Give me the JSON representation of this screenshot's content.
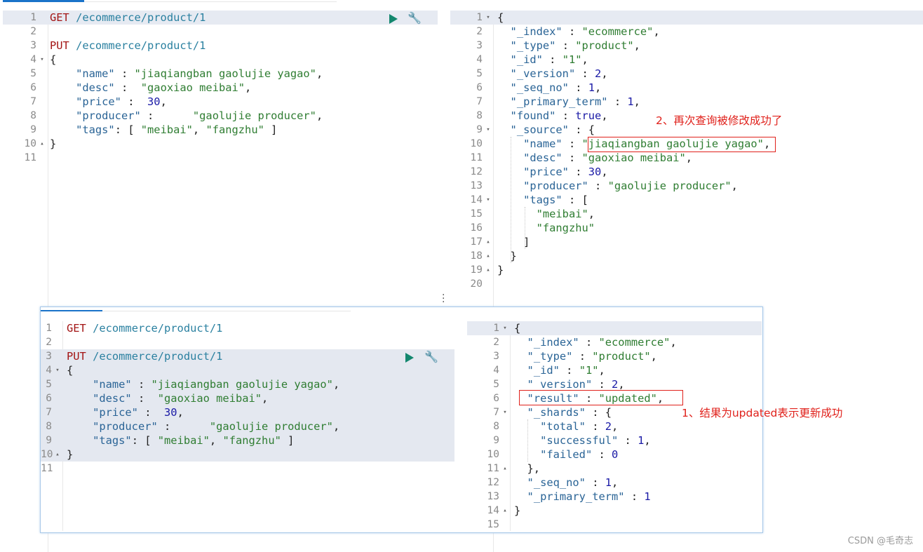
{
  "top_request": {
    "lines": [
      {
        "n": "1",
        "fold": "",
        "parts": [
          [
            "k",
            "GET"
          ],
          [
            "p",
            " "
          ],
          [
            "u",
            "/ecommerce/product/1"
          ]
        ]
      },
      {
        "n": "2",
        "fold": "",
        "parts": []
      },
      {
        "n": "3",
        "fold": "",
        "parts": [
          [
            "k",
            "PUT"
          ],
          [
            "p",
            " "
          ],
          [
            "u",
            "/ecommerce/product/1"
          ]
        ]
      },
      {
        "n": "4",
        "fold": "▾",
        "parts": [
          [
            "p",
            "{"
          ]
        ]
      },
      {
        "n": "5",
        "fold": "",
        "parts": [
          [
            "p",
            "    "
          ],
          [
            "key",
            "\"name\""
          ],
          [
            "p",
            " : "
          ],
          [
            "s",
            "\"jiaqiangban gaolujie yagao\""
          ],
          [
            "p",
            ","
          ]
        ]
      },
      {
        "n": "6",
        "fold": "",
        "parts": [
          [
            "p",
            "    "
          ],
          [
            "key",
            "\"desc\""
          ],
          [
            "p",
            " :  "
          ],
          [
            "s",
            "\"gaoxiao meibai\""
          ],
          [
            "p",
            ","
          ]
        ]
      },
      {
        "n": "7",
        "fold": "",
        "parts": [
          [
            "p",
            "    "
          ],
          [
            "key",
            "\"price\""
          ],
          [
            "p",
            " :  "
          ],
          [
            "n",
            "30"
          ],
          [
            "p",
            ","
          ]
        ]
      },
      {
        "n": "8",
        "fold": "",
        "parts": [
          [
            "p",
            "    "
          ],
          [
            "key",
            "\"producer\""
          ],
          [
            "p",
            " :      "
          ],
          [
            "s",
            "\"gaolujie producer\""
          ],
          [
            "p",
            ","
          ]
        ]
      },
      {
        "n": "9",
        "fold": "",
        "parts": [
          [
            "p",
            "    "
          ],
          [
            "key",
            "\"tags\""
          ],
          [
            "p",
            ": [ "
          ],
          [
            "s",
            "\"meibai\""
          ],
          [
            "p",
            ", "
          ],
          [
            "s",
            "\"fangzhu\""
          ],
          [
            "p",
            " ]"
          ]
        ]
      },
      {
        "n": "10",
        "fold": "▴",
        "parts": [
          [
            "p",
            "}"
          ]
        ]
      },
      {
        "n": "11",
        "fold": "",
        "parts": []
      }
    ]
  },
  "top_response": {
    "lines": [
      {
        "n": "1",
        "fold": "▾",
        "parts": [
          [
            "p",
            "{"
          ]
        ]
      },
      {
        "n": "2",
        "fold": "",
        "parts": [
          [
            "p",
            "  "
          ],
          [
            "key",
            "\"_index\""
          ],
          [
            "p",
            " : "
          ],
          [
            "s",
            "\"ecommerce\""
          ],
          [
            "p",
            ","
          ]
        ]
      },
      {
        "n": "3",
        "fold": "",
        "parts": [
          [
            "p",
            "  "
          ],
          [
            "key",
            "\"_type\""
          ],
          [
            "p",
            " : "
          ],
          [
            "s",
            "\"product\""
          ],
          [
            "p",
            ","
          ]
        ]
      },
      {
        "n": "4",
        "fold": "",
        "parts": [
          [
            "p",
            "  "
          ],
          [
            "key",
            "\"_id\""
          ],
          [
            "p",
            " : "
          ],
          [
            "s",
            "\"1\""
          ],
          [
            "p",
            ","
          ]
        ]
      },
      {
        "n": "5",
        "fold": "",
        "parts": [
          [
            "p",
            "  "
          ],
          [
            "key",
            "\"_version\""
          ],
          [
            "p",
            " : "
          ],
          [
            "n",
            "2"
          ],
          [
            "p",
            ","
          ]
        ]
      },
      {
        "n": "6",
        "fold": "",
        "parts": [
          [
            "p",
            "  "
          ],
          [
            "key",
            "\"_seq_no\""
          ],
          [
            "p",
            " : "
          ],
          [
            "n",
            "1"
          ],
          [
            "p",
            ","
          ]
        ]
      },
      {
        "n": "7",
        "fold": "",
        "parts": [
          [
            "p",
            "  "
          ],
          [
            "key",
            "\"_primary_term\""
          ],
          [
            "p",
            " : "
          ],
          [
            "n",
            "1"
          ],
          [
            "p",
            ","
          ]
        ]
      },
      {
        "n": "8",
        "fold": "",
        "parts": [
          [
            "p",
            "  "
          ],
          [
            "key",
            "\"found\""
          ],
          [
            "p",
            " : "
          ],
          [
            "n",
            "true"
          ],
          [
            "p",
            ","
          ]
        ]
      },
      {
        "n": "9",
        "fold": "▾",
        "parts": [
          [
            "p",
            "  "
          ],
          [
            "key",
            "\"_source\""
          ],
          [
            "p",
            " : {"
          ]
        ]
      },
      {
        "n": "10",
        "fold": "",
        "parts": [
          [
            "p",
            "    "
          ],
          [
            "key",
            "\"name\""
          ],
          [
            "p",
            " : "
          ],
          [
            "s",
            "\"jiaqiangban gaolujie yagao\""
          ],
          [
            "p",
            ","
          ]
        ]
      },
      {
        "n": "11",
        "fold": "",
        "parts": [
          [
            "p",
            "    "
          ],
          [
            "key",
            "\"desc\""
          ],
          [
            "p",
            " : "
          ],
          [
            "s",
            "\"gaoxiao meibai\""
          ],
          [
            "p",
            ","
          ]
        ]
      },
      {
        "n": "12",
        "fold": "",
        "parts": [
          [
            "p",
            "    "
          ],
          [
            "key",
            "\"price\""
          ],
          [
            "p",
            " : "
          ],
          [
            "n",
            "30"
          ],
          [
            "p",
            ","
          ]
        ]
      },
      {
        "n": "13",
        "fold": "",
        "parts": [
          [
            "p",
            "    "
          ],
          [
            "key",
            "\"producer\""
          ],
          [
            "p",
            " : "
          ],
          [
            "s",
            "\"gaolujie producer\""
          ],
          [
            "p",
            ","
          ]
        ]
      },
      {
        "n": "14",
        "fold": "▾",
        "parts": [
          [
            "p",
            "    "
          ],
          [
            "key",
            "\"tags\""
          ],
          [
            "p",
            " : ["
          ]
        ]
      },
      {
        "n": "15",
        "fold": "",
        "parts": [
          [
            "p",
            "      "
          ],
          [
            "s",
            "\"meibai\""
          ],
          [
            "p",
            ","
          ]
        ]
      },
      {
        "n": "16",
        "fold": "",
        "parts": [
          [
            "p",
            "      "
          ],
          [
            "s",
            "\"fangzhu\""
          ]
        ]
      },
      {
        "n": "17",
        "fold": "▴",
        "parts": [
          [
            "p",
            "    ]"
          ]
        ]
      },
      {
        "n": "18",
        "fold": "▴",
        "parts": [
          [
            "p",
            "  }"
          ]
        ]
      },
      {
        "n": "19",
        "fold": "▴",
        "parts": [
          [
            "p",
            "}"
          ]
        ]
      },
      {
        "n": "20",
        "fold": "",
        "parts": []
      }
    ]
  },
  "bottom_request": {
    "lines": [
      {
        "n": "1",
        "fold": "",
        "parts": [
          [
            "k",
            "GET"
          ],
          [
            "p",
            " "
          ],
          [
            "u",
            "/ecommerce/product/1"
          ]
        ]
      },
      {
        "n": "2",
        "fold": "",
        "parts": []
      },
      {
        "n": "3",
        "fold": "",
        "parts": [
          [
            "k",
            "PUT"
          ],
          [
            "p",
            " "
          ],
          [
            "u",
            "/ecommerce/product/1"
          ]
        ]
      },
      {
        "n": "4",
        "fold": "▾",
        "parts": [
          [
            "p",
            "{"
          ]
        ]
      },
      {
        "n": "5",
        "fold": "",
        "parts": [
          [
            "p",
            "    "
          ],
          [
            "key",
            "\"name\""
          ],
          [
            "p",
            " : "
          ],
          [
            "s",
            "\"jiaqiangban gaolujie yagao\""
          ],
          [
            "p",
            ","
          ]
        ]
      },
      {
        "n": "6",
        "fold": "",
        "parts": [
          [
            "p",
            "    "
          ],
          [
            "key",
            "\"desc\""
          ],
          [
            "p",
            " :  "
          ],
          [
            "s",
            "\"gaoxiao meibai\""
          ],
          [
            "p",
            ","
          ]
        ]
      },
      {
        "n": "7",
        "fold": "",
        "parts": [
          [
            "p",
            "    "
          ],
          [
            "key",
            "\"price\""
          ],
          [
            "p",
            " :  "
          ],
          [
            "n",
            "30"
          ],
          [
            "p",
            ","
          ]
        ]
      },
      {
        "n": "8",
        "fold": "",
        "parts": [
          [
            "p",
            "    "
          ],
          [
            "key",
            "\"producer\""
          ],
          [
            "p",
            " :      "
          ],
          [
            "s",
            "\"gaolujie producer\""
          ],
          [
            "p",
            ","
          ]
        ]
      },
      {
        "n": "9",
        "fold": "",
        "parts": [
          [
            "p",
            "    "
          ],
          [
            "key",
            "\"tags\""
          ],
          [
            "p",
            ": [ "
          ],
          [
            "s",
            "\"meibai\""
          ],
          [
            "p",
            ", "
          ],
          [
            "s",
            "\"fangzhu\""
          ],
          [
            "p",
            " ]"
          ]
        ]
      },
      {
        "n": "10",
        "fold": "▴",
        "parts": [
          [
            "p",
            "}"
          ]
        ]
      },
      {
        "n": "11",
        "fold": "",
        "parts": []
      }
    ]
  },
  "bottom_response": {
    "lines": [
      {
        "n": "1",
        "fold": "▾",
        "parts": [
          [
            "p",
            "{"
          ]
        ]
      },
      {
        "n": "2",
        "fold": "",
        "parts": [
          [
            "p",
            "  "
          ],
          [
            "key",
            "\"_index\""
          ],
          [
            "p",
            " : "
          ],
          [
            "s",
            "\"ecommerce\""
          ],
          [
            "p",
            ","
          ]
        ]
      },
      {
        "n": "3",
        "fold": "",
        "parts": [
          [
            "p",
            "  "
          ],
          [
            "key",
            "\"_type\""
          ],
          [
            "p",
            " : "
          ],
          [
            "s",
            "\"product\""
          ],
          [
            "p",
            ","
          ]
        ]
      },
      {
        "n": "4",
        "fold": "",
        "parts": [
          [
            "p",
            "  "
          ],
          [
            "key",
            "\"_id\""
          ],
          [
            "p",
            " : "
          ],
          [
            "s",
            "\"1\""
          ],
          [
            "p",
            ","
          ]
        ]
      },
      {
        "n": "5",
        "fold": "",
        "parts": [
          [
            "p",
            "  "
          ],
          [
            "key",
            "\"_version\""
          ],
          [
            "p",
            " : "
          ],
          [
            "n",
            "2"
          ],
          [
            "p",
            ","
          ]
        ]
      },
      {
        "n": "6",
        "fold": "",
        "parts": [
          [
            "p",
            "  "
          ],
          [
            "key",
            "\"result\""
          ],
          [
            "p",
            " : "
          ],
          [
            "s",
            "\"updated\""
          ],
          [
            "p",
            ","
          ]
        ]
      },
      {
        "n": "7",
        "fold": "▾",
        "parts": [
          [
            "p",
            "  "
          ],
          [
            "key",
            "\"_shards\""
          ],
          [
            "p",
            " : {"
          ]
        ]
      },
      {
        "n": "8",
        "fold": "",
        "parts": [
          [
            "p",
            "    "
          ],
          [
            "key",
            "\"total\""
          ],
          [
            "p",
            " : "
          ],
          [
            "n",
            "2"
          ],
          [
            "p",
            ","
          ]
        ]
      },
      {
        "n": "9",
        "fold": "",
        "parts": [
          [
            "p",
            "    "
          ],
          [
            "key",
            "\"successful\""
          ],
          [
            "p",
            " : "
          ],
          [
            "n",
            "1"
          ],
          [
            "p",
            ","
          ]
        ]
      },
      {
        "n": "10",
        "fold": "",
        "parts": [
          [
            "p",
            "    "
          ],
          [
            "key",
            "\"failed\""
          ],
          [
            "p",
            " : "
          ],
          [
            "n",
            "0"
          ]
        ]
      },
      {
        "n": "11",
        "fold": "▴",
        "parts": [
          [
            "p",
            "  },"
          ]
        ]
      },
      {
        "n": "12",
        "fold": "",
        "parts": [
          [
            "p",
            "  "
          ],
          [
            "key",
            "\"_seq_no\""
          ],
          [
            "p",
            " : "
          ],
          [
            "n",
            "1"
          ],
          [
            "p",
            ","
          ]
        ]
      },
      {
        "n": "13",
        "fold": "",
        "parts": [
          [
            "p",
            "  "
          ],
          [
            "key",
            "\"_primary_term\""
          ],
          [
            "p",
            " : "
          ],
          [
            "n",
            "1"
          ]
        ]
      },
      {
        "n": "14",
        "fold": "▴",
        "parts": [
          [
            "p",
            "}"
          ]
        ]
      },
      {
        "n": "15",
        "fold": "",
        "parts": []
      }
    ]
  },
  "annotations": {
    "second": "2、再次查询被修改成功了",
    "first": "1、结果为updated表示更新成功"
  },
  "icons": {
    "run": "play-icon",
    "settings": "wrench-icon",
    "resize": "vertical-dots-icon"
  },
  "colors": {
    "keyword": "#a31515",
    "url": "#2a80a0",
    "string": "#2f7d32",
    "number": "#1a1aa6",
    "annotation": "#e0211b",
    "run_button": "#13876e",
    "tab_indicator": "#1a73c9"
  },
  "watermark": "CSDN @毛奇志"
}
